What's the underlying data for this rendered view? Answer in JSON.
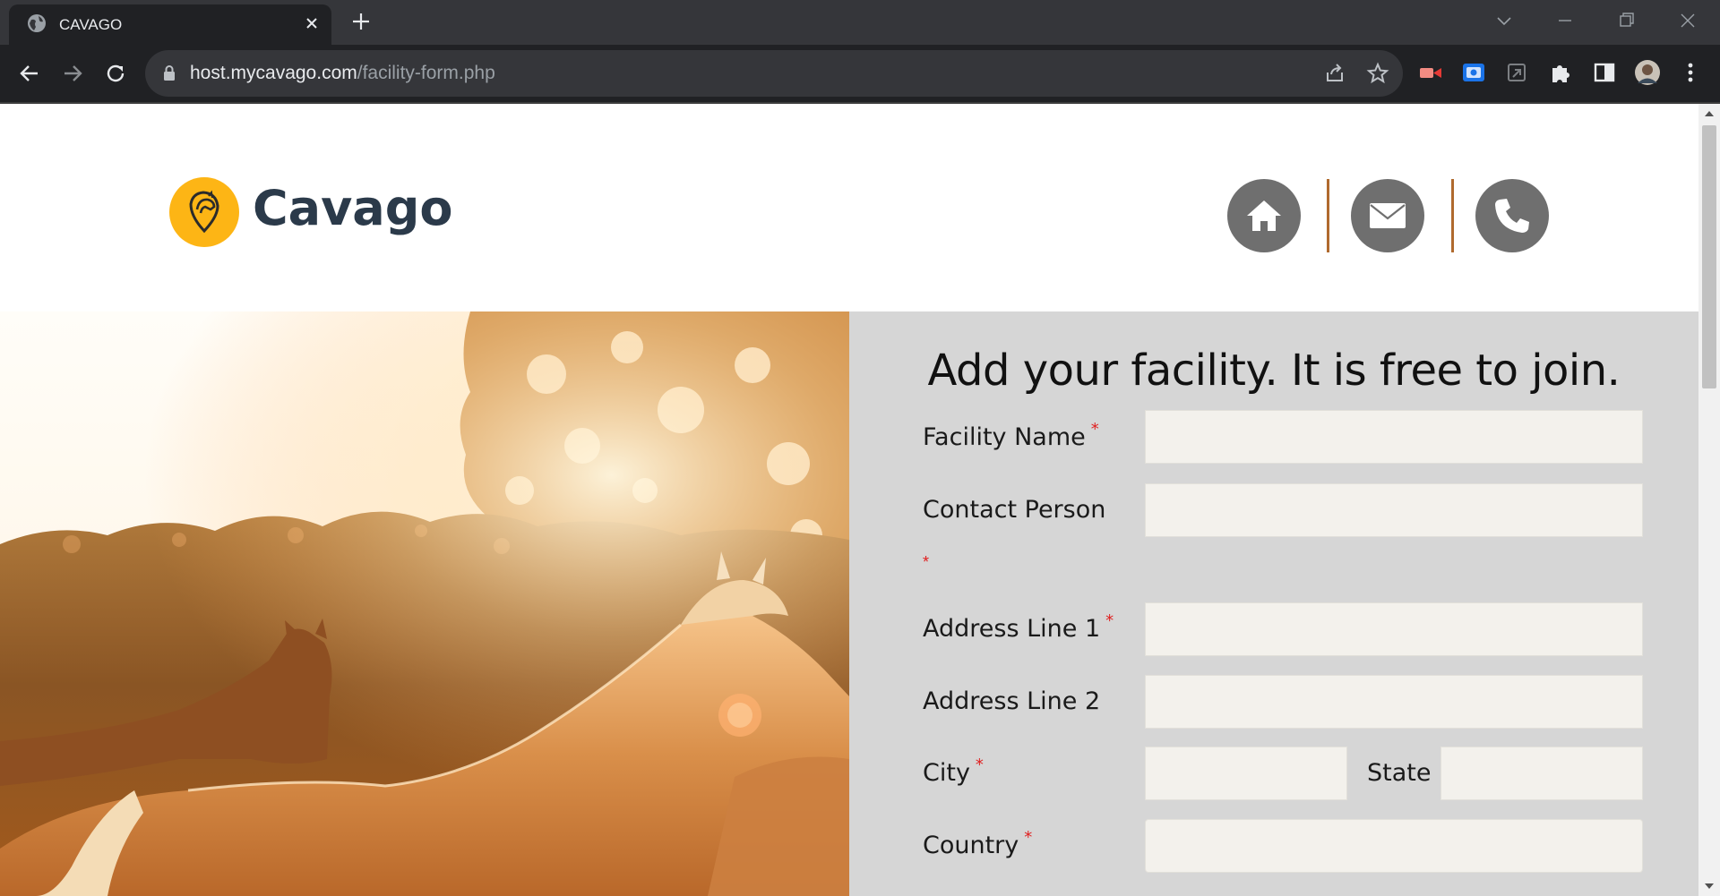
{
  "browser": {
    "tab_title": "CAVAGO",
    "url_host": "host.mycavago.com",
    "url_path": "/facility-form.php"
  },
  "site": {
    "brand_name": "Cavago",
    "brand_color": "#fdb515",
    "nav_circle_color": "#6f6f6f",
    "nav_separator_color": "#b06a2e"
  },
  "form": {
    "title": "Add your facility. It is free to join.",
    "required_mark": "*",
    "fields": {
      "facility_name": {
        "label": "Facility Name",
        "value": "",
        "required": true
      },
      "contact_person": {
        "label": "Contact Person",
        "value": "",
        "required": true
      },
      "address_line_1": {
        "label": "Address Line 1",
        "value": "",
        "required": true
      },
      "address_line_2": {
        "label": "Address Line 2",
        "value": "",
        "required": false
      },
      "city": {
        "label": "City",
        "value": "",
        "required": true
      },
      "state": {
        "label": "State",
        "value": "",
        "required": false
      },
      "country": {
        "label": "Country",
        "value": "",
        "required": true
      }
    },
    "panel_color": "#d6d6d6",
    "input_color": "#f3f1ec"
  }
}
